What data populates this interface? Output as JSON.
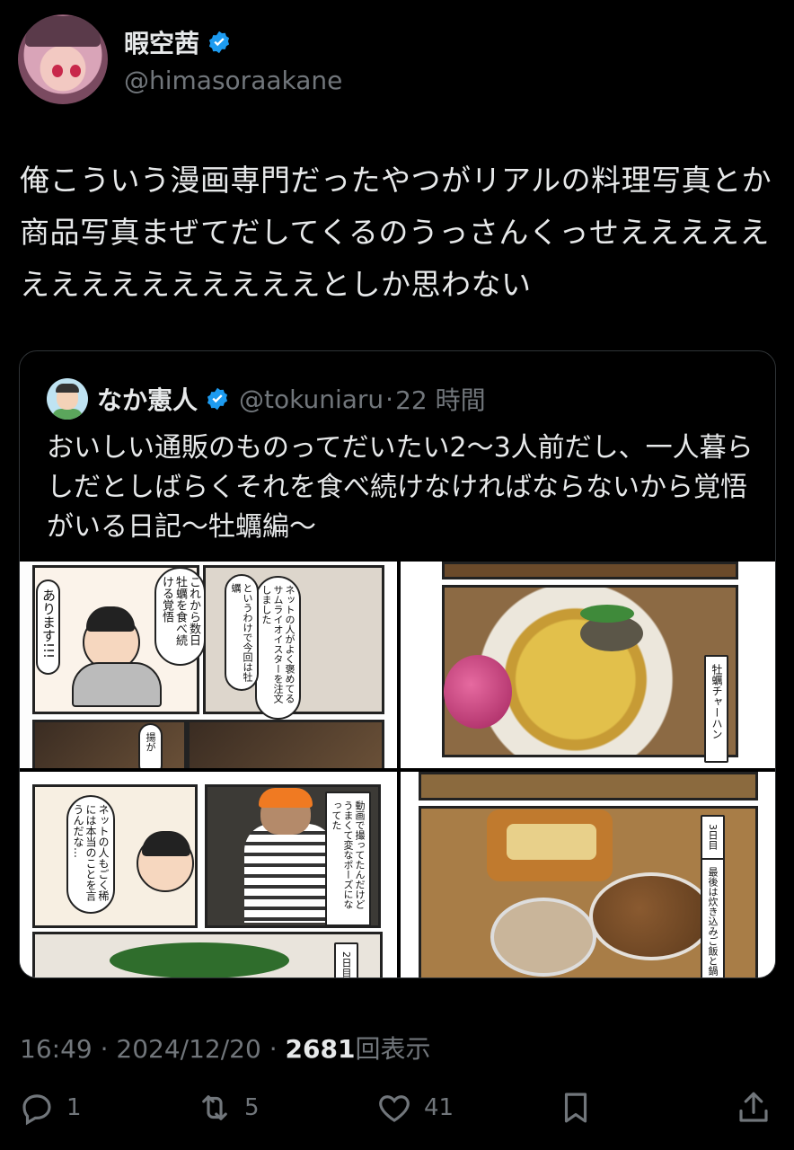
{
  "author": {
    "display_name": "暇空茜",
    "handle": "@himasoraakane"
  },
  "tweet_text": "俺こういう漫画専門だったやつがリアルの料理写真とか商品写真まぜてだしてくるのうっさんくっせえええええええええええええええとしか思わない",
  "quote": {
    "display_name": "なか憲人",
    "handle": "@tokuniaru",
    "separator": "·",
    "time": "22 時間",
    "text": "おいしい通販のものってだいたい2〜3人前だし、一人暮らしだとしばらくそれを食べ続けなければならないから覚悟がいる日記〜牡蠣編〜",
    "media_text": {
      "p1_bubble1": "これから数日牡蠣を食べ続ける覚悟",
      "p1_bubble2": "あります!!!",
      "p1_bubble3": "というわけで今回は牡蠣",
      "p1_bubble4": "ネットの人がよく褒めてるサムライオイスターを注文しました",
      "p1_bubble5": "揚が",
      "p2_caption": "牡蠣チャーハン",
      "p3_bubble1": "ネットの人もごく稀には本当のことを言うんだな…",
      "p3_bubble2": "動画で撮ってたんだけどうまくて変なポーズになってた",
      "p3_caption": "2日目",
      "p4_caption1": "3日目",
      "p4_caption2": "最後は炊き込みご飯と鍋"
    }
  },
  "meta": {
    "time": "16:49",
    "dot1": "·",
    "date": "2024/12/20",
    "dot2": "·",
    "views": "2681",
    "views_label": "回表示"
  },
  "actions": {
    "reply_count": "1",
    "retweet_count": "5",
    "like_count": "41"
  },
  "colors": {
    "background": "#000000",
    "text": "#e7e9ea",
    "secondary": "#71767b",
    "verified": "#1d9bf0",
    "border": "#2f3336"
  },
  "icons": [
    "verified-badge-icon",
    "reply-icon",
    "retweet-icon",
    "like-icon",
    "bookmark-icon",
    "share-icon"
  ]
}
